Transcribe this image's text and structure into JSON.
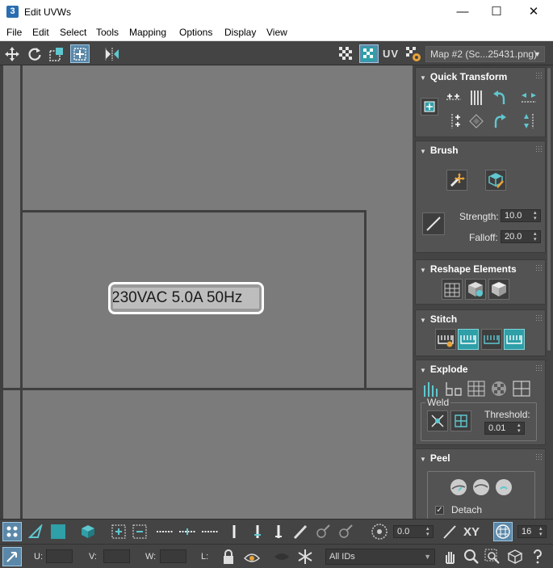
{
  "window": {
    "app_icon_text": "3",
    "title": "Edit UVWs",
    "minimize": "—",
    "maximize": "☐",
    "close": "✕"
  },
  "menu": [
    "File",
    "Edit",
    "Select",
    "Tools",
    "Mapping",
    "Options",
    "Display",
    "View"
  ],
  "toolbar": {
    "uv_label": "UV",
    "map_select": "Map #2 (Sc...25431.png)"
  },
  "viewport": {
    "texture_text": "230VAC 5.0A 50Hz"
  },
  "panel": {
    "quick_transform": {
      "title": "Quick Transform"
    },
    "brush": {
      "title": "Brush",
      "strength_label": "Strength:",
      "strength_value": "10.0",
      "falloff_label": "Falloff:",
      "falloff_value": "20.0"
    },
    "reshape": {
      "title": "Reshape Elements"
    },
    "stitch": {
      "title": "Stitch"
    },
    "explode": {
      "title": "Explode",
      "weld_label": "Weld",
      "threshold_label": "Threshold:",
      "threshold_value": "0.01"
    },
    "peel": {
      "title": "Peel",
      "detach_label": "Detach",
      "detach_checked": true
    }
  },
  "bottom": {
    "angle_value": "0.0",
    "xy_label": "XY",
    "grid_value": "16",
    "u_label": "U:",
    "v_label": "V:",
    "w_label": "W:",
    "l_label": "L:",
    "ids_select": "All IDs"
  },
  "colors": {
    "accent_teal": "#2f9fa8",
    "active_blue": "#5b88a8",
    "viewport_bg": "#7b7b7b",
    "panel_bg": "#444444"
  }
}
